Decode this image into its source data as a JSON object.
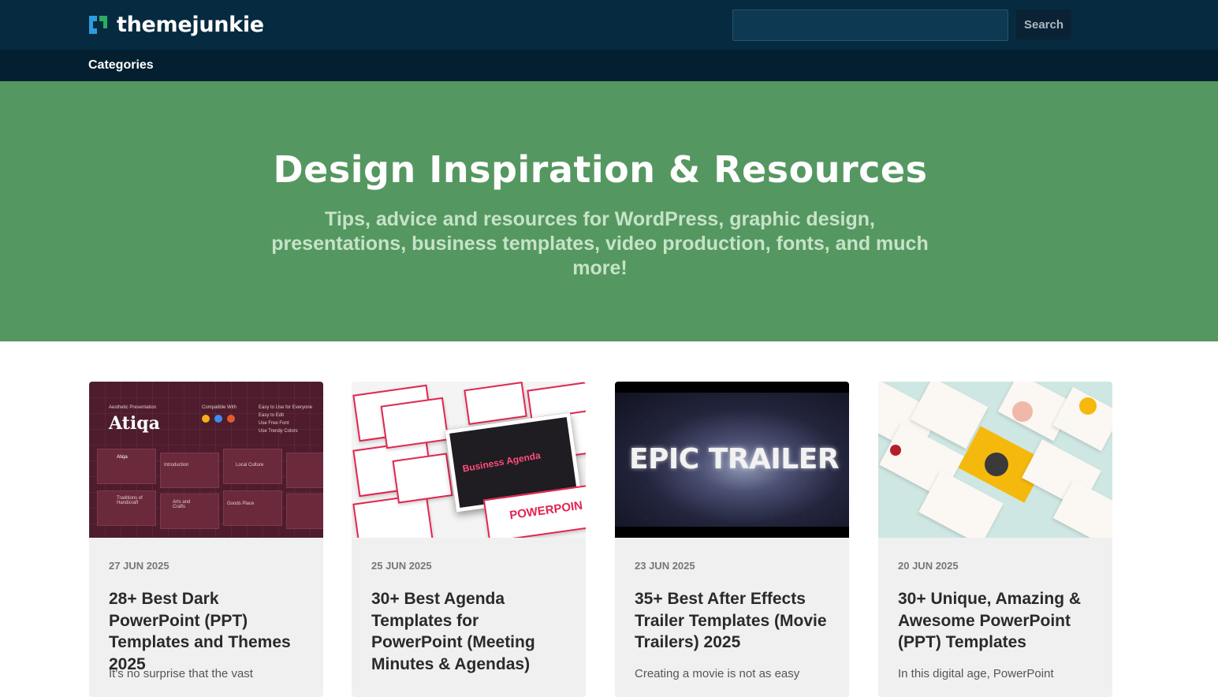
{
  "header": {
    "brand": "themejunkie",
    "search": {
      "value": "",
      "placeholder": "",
      "button_label": "Search"
    }
  },
  "nav": {
    "categories_label": "Categories"
  },
  "hero": {
    "title": "Design Inspiration & Resources",
    "subtitle": "Tips, advice and resources for WordPress, graphic design, presentations, business templates, video production, fonts, and much more!"
  },
  "thumbnails": {
    "atiqa": {
      "kicker": "Aesthetic Presentation",
      "name": "Atiqa",
      "compatible": "Compatible With",
      "features": [
        "Easy to Use for Everyone",
        "Easy to Edit",
        "Use Free Font",
        "Use Trendy Colors"
      ],
      "slides": [
        "Atiqa",
        "Introduction",
        "Local Culture",
        "Traditions of Handicraft",
        "Arts and Crafts",
        "Goods Place"
      ]
    },
    "agenda": {
      "headline": "Business Agenda",
      "footer_word": "POWERPOIN"
    },
    "trailer": {
      "headline": "EPIC TRAILER"
    }
  },
  "colors": {
    "topbar": "#062a40",
    "navbar": "#041f30",
    "hero_bg": "#559760",
    "card_bg": "#f0f0f0"
  },
  "articles": [
    {
      "date": "27 JUN 2025",
      "title": "28+ Best Dark PowerPoint (PPT) Templates and Themes 2025",
      "excerpt": "It's no surprise that the vast"
    },
    {
      "date": "25 JUN 2025",
      "title": "30+ Best Agenda Templates for PowerPoint (Meeting Minutes & Agendas)",
      "excerpt": ""
    },
    {
      "date": "23 JUN 2025",
      "title": "35+ Best After Effects Trailer Templates (Movie Trailers) 2025",
      "excerpt": "Creating a movie is not as easy"
    },
    {
      "date": "20 JUN 2025",
      "title": "30+ Unique, Amazing & Awesome PowerPoint (PPT) Templates",
      "excerpt": "In this digital age, PowerPoint"
    }
  ]
}
